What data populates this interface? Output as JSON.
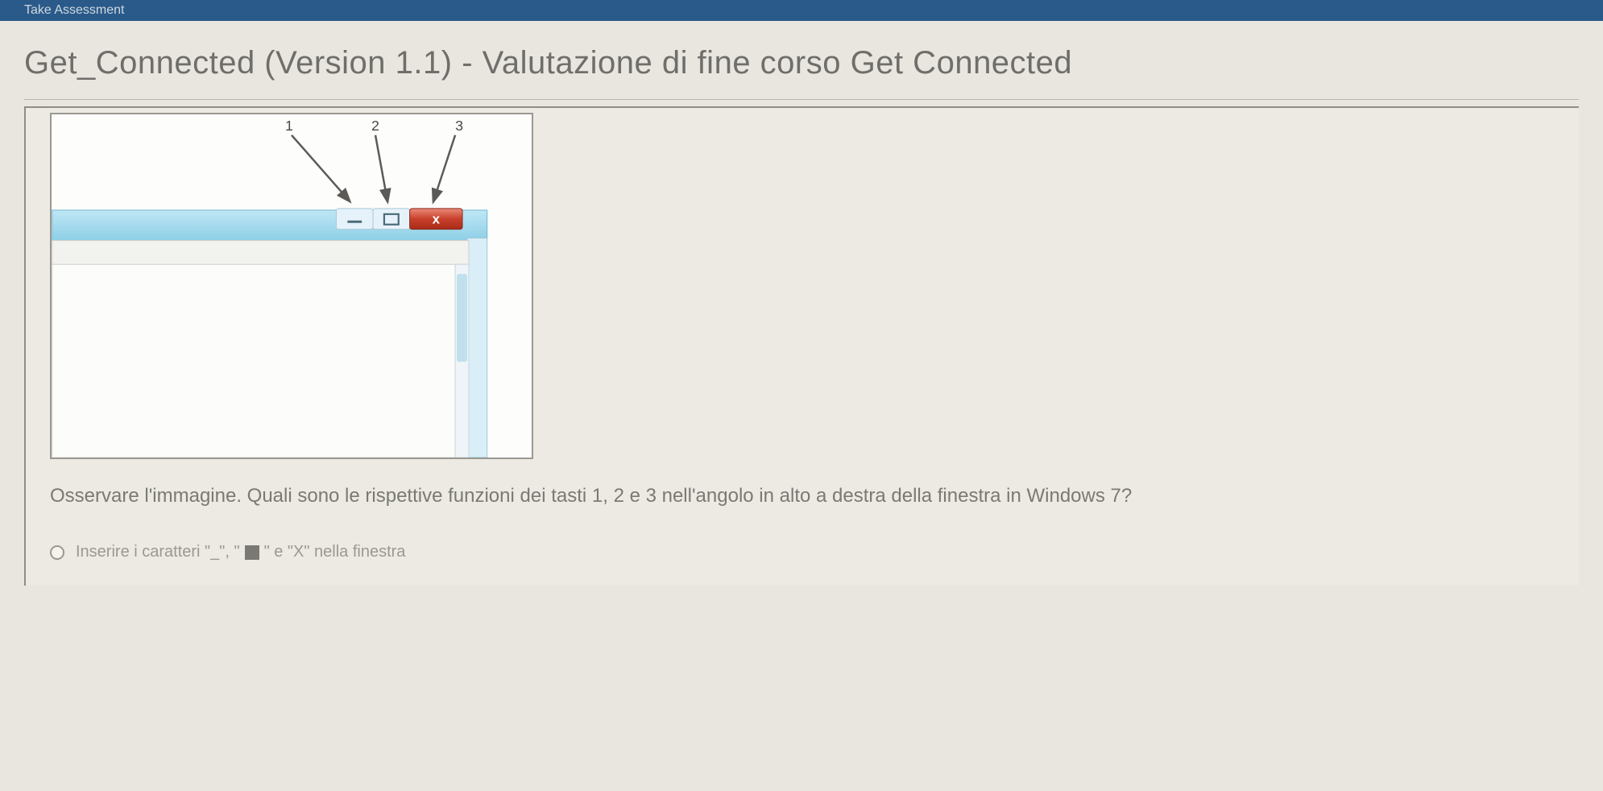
{
  "topbar": {
    "text": "Take Assessment"
  },
  "title": "Get_Connected (Version 1.1) - Valutazione di fine corso Get Connected",
  "figure": {
    "labels": {
      "n1": "1",
      "n2": "2",
      "n3": "3"
    },
    "buttons": {
      "min_glyph": "—",
      "max_glyph": "❐",
      "close_glyph": "x"
    }
  },
  "question": "Osservare l'immagine. Quali sono le rispettive funzioni dei tasti 1, 2 e 3 nell'angolo in alto a destra della finestra in Windows 7?",
  "options": [
    {
      "pre": "Inserire i caratteri \"_\", \"",
      "post": "\" e \"X\" nella finestra"
    }
  ]
}
